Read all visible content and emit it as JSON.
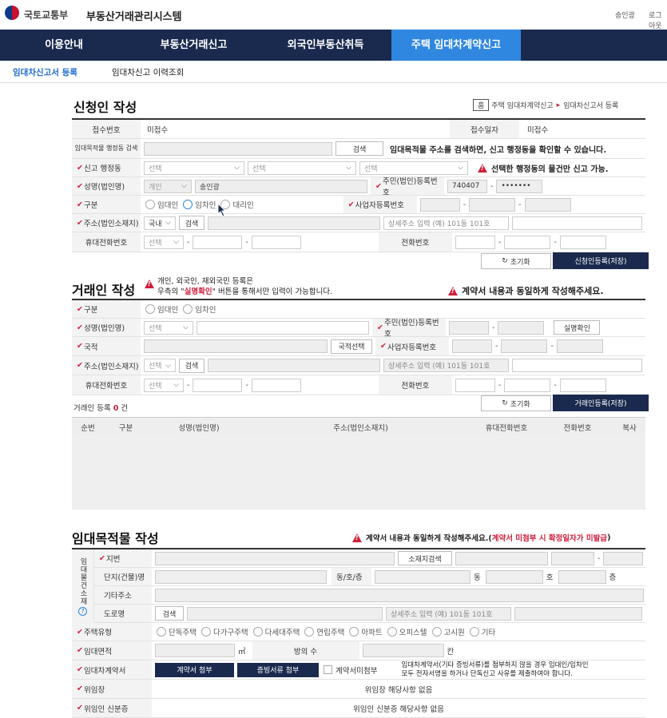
{
  "header": {
    "org": "국토교통부",
    "system": "부동산거래관리시스템",
    "user": "송인광",
    "logout": "로그아웃"
  },
  "nav": [
    "이용안내",
    "부동산거래신고",
    "외국인부동산취득",
    "주택 임대차계약신고"
  ],
  "subnav": [
    "임대차신고서 등록",
    "임대차신고 이력조회"
  ],
  "breadcrumb": {
    "home": "홈",
    "path1": "주택 임대차계약신고",
    "path2": "임대차신고서 등록"
  },
  "applicant": {
    "title": "신청인 작성",
    "receipt_no_label": "접수번호",
    "receipt_no": "미접수",
    "receipt_date_label": "접수일자",
    "receipt_date": "미접수",
    "admin_search_label": "임대목적물 행정동 검색",
    "search_btn": "검색",
    "admin_search_hint": "임대목적물 주소를 검색하면, 신고 행정동을 확인할 수 있습니다.",
    "report_dong_label": "신고 행정동",
    "select": "선택",
    "report_dong_warn": "선택한 행정동의 물건만 신고 가능.",
    "name_label": "성명(법인명)",
    "person_type": "개인",
    "name_value": "송인광",
    "rrn_label": "주민(법인)등록번호",
    "rrn_front": "740407",
    "rrn_back": "•••••••",
    "type_label": "구분",
    "type_options": [
      "임대인",
      "임차인",
      "대리인"
    ],
    "bizno_label": "사업자등록번호",
    "addr_label": "주소(법인소재지)",
    "addr_country": "국내",
    "addr_detail_ph": "상세주소 입력 (예) 101동 101호",
    "mobile_label": "휴대전화번호",
    "phone_label": "전화번호",
    "reset_btn": "초기화",
    "save_btn": "신청인등록(저장)"
  },
  "party": {
    "title": "거래인 작성",
    "note1": "개인, 외국인, 재외국민 등록은",
    "note2a": "우측의 \"",
    "note2b": "실명확인",
    "note2c": "\" 버튼을 통해서만 입력이 가능합니다.",
    "warn": "계약서 내용과 동일하게 작성해주세요.",
    "type_label": "구분",
    "type_options": [
      "임대인",
      "임차인"
    ],
    "name_label": "성명(법인명)",
    "rrn_label": "주민(법인)등록번호",
    "verify_btn": "실명확인",
    "nation_label": "국적",
    "nation_btn": "국적선택",
    "bizno_label": "사업자등록번호",
    "addr_label": "주소(법인소재지)",
    "addr_detail_ph": "상세주소 입력 (예) 101동 101호",
    "mobile_label": "휴대전화번호",
    "phone_label": "전화번호",
    "count_prefix": "거래인 등록",
    "count": "0",
    "count_suffix": "건",
    "reset_btn": "초기화",
    "save_btn": "거래인등록(저장)",
    "columns": [
      "순번",
      "구분",
      "성명(법인명)",
      "주소(법인소재지)",
      "휴대전화번호",
      "전화번호",
      "복사"
    ]
  },
  "property": {
    "title": "임대목적물 작성",
    "warn_a": "계약서 내용과 동일하게 작성해주세요.(",
    "warn_b": "계약서 미첨부 시 확정일자가 미발급",
    "warn_c": ")",
    "side_label": "임대물건소재",
    "lot_label": "지번",
    "location_btn": "소재지검색",
    "complex_label": "단지(건물)명",
    "dong_ho_label": "동/호/층",
    "dong": "동",
    "ho": "호",
    "floor": "층",
    "etc_label": "기타주소",
    "road_label": "도로명",
    "road_search": "검색",
    "road_detail_ph": "상세주소 입력 (예) 101동 101호",
    "house_type_label": "주택유형",
    "house_types": [
      "단독주택",
      "다가구주택",
      "다세대주택",
      "연립주택",
      "아파트",
      "오피스텔",
      "고시원",
      "기타"
    ],
    "area_label": "임대면적",
    "area_unit": "㎡",
    "rooms_label": "방의 수",
    "rooms_unit": "칸",
    "contract_label": "임대차계약서",
    "attach_contract": "계약서 첨부",
    "attach_proof": "증빙서류 첨부",
    "no_attach": "계약서미첨부",
    "contract_note1": "임대차계약서(기타 증빙서류)를 첨부하지 않을 경우 임대인/임차인",
    "contract_note2": "모두 전자서명을 하거나 단독신고 사유를 제출하여야 합니다.",
    "delegation_label": "위임장",
    "delegation_value": "위임장 해당사항 없음",
    "delegator_id_label": "위임인 신분증",
    "delegator_id_value": "위임인 신분증 해당사항 없음"
  }
}
